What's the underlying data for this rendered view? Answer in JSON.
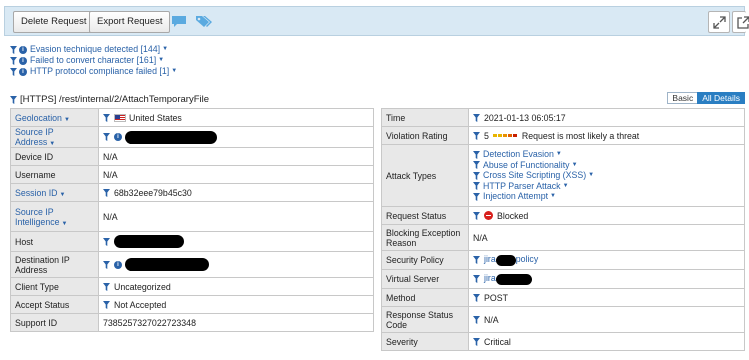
{
  "toolbar": {
    "delete_label": "Delete Request",
    "export_label": "Export Request"
  },
  "filters": [
    {
      "label": "Evasion technique detected [144]"
    },
    {
      "label": "Failed to convert character [161]"
    },
    {
      "label": "HTTP protocol compliance failed [1]"
    }
  ],
  "request": {
    "title": "[HTTPS] /rest/internal/2/AttachTemporaryFile",
    "view_basic": "Basic",
    "view_all": "All Details"
  },
  "left": {
    "geolocation": {
      "key": "Geolocation",
      "value": "United States"
    },
    "source_ip": {
      "key": "Source IP Address"
    },
    "device_id": {
      "key": "Device ID",
      "value": "N/A"
    },
    "username": {
      "key": "Username",
      "value": "N/A"
    },
    "session_id": {
      "key": "Session ID",
      "value": "68b32eee79b45c30"
    },
    "source_ip_intel": {
      "key_line1": "Source IP",
      "key_line2": "Intelligence",
      "value": "N/A"
    },
    "host": {
      "key": "Host"
    },
    "dest_ip": {
      "key_line1": "Destination IP",
      "key_line2": "Address"
    },
    "client_type": {
      "key": "Client Type",
      "value": "Uncategorized"
    },
    "accept_status": {
      "key": "Accept Status",
      "value": "Not Accepted"
    },
    "support_id": {
      "key": "Support ID",
      "value": "7385257327022723348"
    }
  },
  "right": {
    "time": {
      "key": "Time",
      "value": "2021-01-13 06:05:17"
    },
    "violation": {
      "key": "Violation Rating",
      "rating": "5",
      "text": "Request is most likely a threat"
    },
    "attack_types": {
      "key": "Attack Types",
      "items": [
        "Detection Evasion",
        "Abuse of Functionality",
        "Cross Site Scripting (XSS)",
        "HTTP Parser Attack",
        "Injection Attempt"
      ]
    },
    "request_status": {
      "key": "Request Status",
      "value": "Blocked"
    },
    "blocking_reason": {
      "key_line1": "Blocking Exception",
      "key_line2": "Reason",
      "value": "N/A"
    },
    "security_policy": {
      "key": "Security Policy",
      "prefix": "jira",
      "suffix": "policy"
    },
    "virtual_server": {
      "key": "Virtual Server",
      "prefix": "jira"
    },
    "method": {
      "key": "Method",
      "value": "POST"
    },
    "response_status": {
      "key_line1": "Response Status",
      "key_line2": "Code",
      "value": "N/A"
    },
    "severity": {
      "key": "Severity",
      "value": "Critical"
    }
  },
  "colors": {
    "toolbar_bg": "#d9e9f4",
    "link": "#2a62a8",
    "key_bg": "#e8e8e8",
    "blocked": "#d8201d",
    "rating_bars": [
      "#e8b400",
      "#e8b400",
      "#e89000",
      "#e06000",
      "#c82000"
    ]
  },
  "icons": [
    "filter-icon",
    "info-icon",
    "chat-icon",
    "tags-icon",
    "expand-icon",
    "external-link-icon",
    "us-flag-icon",
    "blocked-icon"
  ]
}
